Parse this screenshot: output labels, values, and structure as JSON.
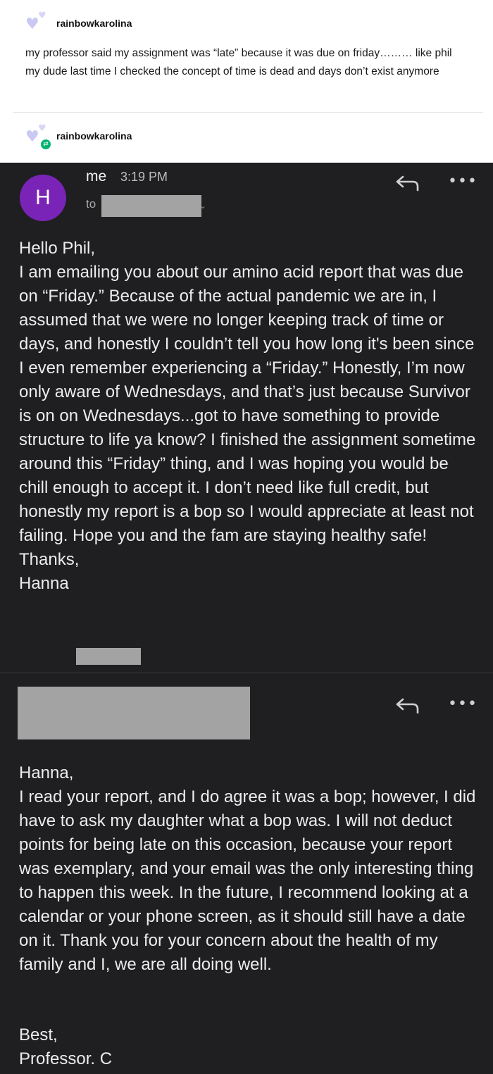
{
  "post": {
    "username": "rainbowkarolina",
    "text": "my professor said my assignment was “late” because it was due on friday……… like phil my dude last time I checked the concept of time is dead and days don’t exist anymore",
    "reblog_username": "rainbowkarolina"
  },
  "email1": {
    "avatar_letter": "H",
    "sender": "me",
    "time": "3:19 PM",
    "to_label": "to",
    "greeting": "Hello Phil,",
    "body": "I am emailing you about our amino acid report that was due on “Friday.” Because of the actual pandemic we are in, I assumed that we were no longer keeping track of time or days, and honestly I couldn’t tell you how long it's been since I even remember experiencing a “Friday.” Honestly, I’m now only aware of Wednesdays, and that’s just because Survivor is on on Wednesdays...got to have something to provide structure to life ya know? I finished the assignment sometime around this “Friday” thing, and I was hoping you would be chill enough to accept it. I don’t need like full credit, but honestly my report is a bop so I would appreciate at least not failing. Hope you and the fam are staying healthy safe!",
    "closing": "Thanks,",
    "signature": "Hanna"
  },
  "email2": {
    "greeting": "Hanna,",
    "body": "I read your report, and I do agree it was a bop; however, I did have to ask my daughter what a bop was. I will not deduct points for being late on this occasion, because your report was exemplary, and your email was the only interesting thing to happen this week. In the future, I recommend looking at a calendar or your phone screen, as it should still have a date on it. Thank you for your concern about the health of my family and I, we are all doing well.",
    "closing": "Best,",
    "signature": "Professor. C"
  },
  "icons": {
    "heart_avatar": "heart-avatar-icon",
    "reblog": "reblog-icon",
    "reply": "reply-icon",
    "more": "more-options-icon",
    "chevron": "chevron-down-icon"
  },
  "colors": {
    "email_bg": "#1f1f22",
    "avatar_purple": "#7a24b7",
    "reblog_green": "#00b46f",
    "redaction_gray": "#a3a3a3"
  }
}
